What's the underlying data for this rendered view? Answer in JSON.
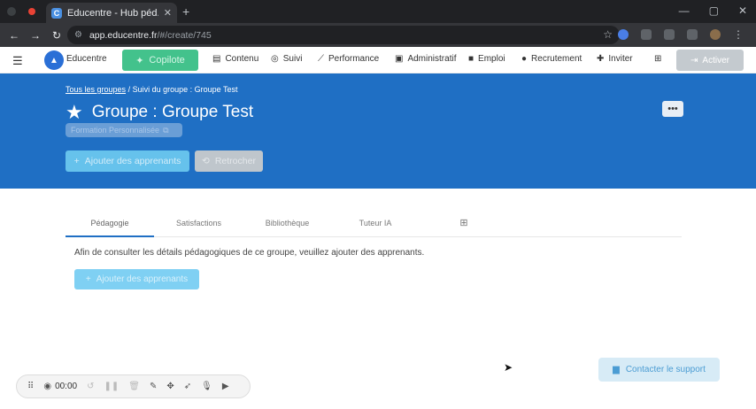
{
  "browser": {
    "tab_title": "Educentre - Hub péd...",
    "favicon_letter": "C",
    "tab_close": "✕",
    "new_tab": "+",
    "url_domain": "app.educentre.fr",
    "url_path": "/#/create/745"
  },
  "nav": {
    "brand": "Educentre",
    "copilote": "Copilote",
    "items": [
      {
        "label": "Contenu",
        "icon": "book-icon"
      },
      {
        "label": "Suivi",
        "icon": "check-circle-icon"
      },
      {
        "label": "Performance",
        "icon": "chart-line-icon"
      },
      {
        "label": "Administratif",
        "icon": "document-icon"
      },
      {
        "label": "Emploi",
        "icon": "briefcase-icon"
      },
      {
        "label": "Recrutement",
        "icon": "person-icon"
      },
      {
        "label": "Inviter",
        "icon": "person-add-icon"
      }
    ],
    "activer": "Activer"
  },
  "hero": {
    "breadcrumb_root": "Tous les groupes",
    "breadcrumb_sep": "/",
    "breadcrumb_current": "Suivi du groupe : Groupe Test",
    "title": "Groupe : Groupe Test",
    "pill_text": "Formation Personnalisée",
    "more_label": "•••",
    "add_learners": "Ajouter des apprenants",
    "retrocher": "Retrocher"
  },
  "tabs": [
    {
      "label": "Pédagogie",
      "active": true
    },
    {
      "label": "Satisfactions",
      "active": false
    },
    {
      "label": "Bibliothèque",
      "active": false
    },
    {
      "label": "Tuteur IA",
      "active": false
    },
    {
      "label": "⊞",
      "active": false
    }
  ],
  "content": {
    "info_text": "Afin de consulter les détails pédagogiques de ce groupe, veuillez ajouter des apprenants.",
    "add_learners": "Ajouter des apprenants"
  },
  "support": {
    "label": "Contacter le support"
  },
  "recorder": {
    "time": "00:00"
  },
  "colors": {
    "brand_blue": "#1f6fc4",
    "copilote_green": "#43c28c",
    "button_cyan": "#66c2ec"
  }
}
